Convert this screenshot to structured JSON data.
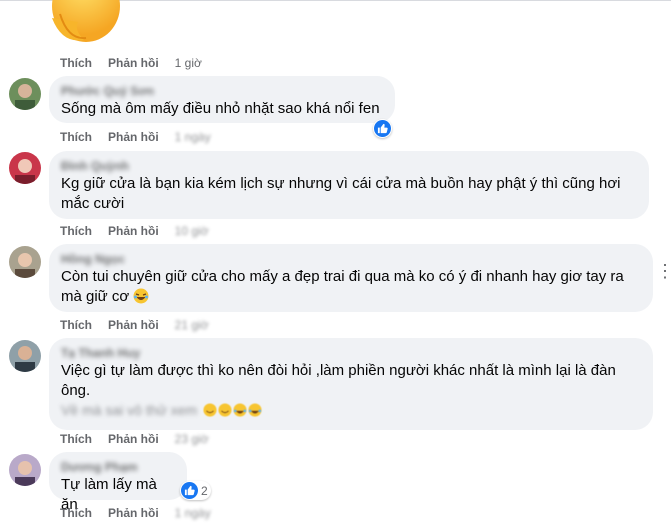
{
  "actions": {
    "like": "Thích",
    "reply": "Phản hồi"
  },
  "top": {
    "time": "1 giờ"
  },
  "comments": [
    {
      "name": "Phước Quý Sơn",
      "text": "Sống mà ôm mấy điều nhỏ nhặt sao khá nổi fen",
      "time": "1 ngày"
    },
    {
      "name": "Đình Quỳnh",
      "text_line1": "Kg giữ cửa là bạn kia kém lịch sự nhưng vì cái cửa mà buồn hay phật ý thì cũng hơi",
      "text_line2": "mắc cười",
      "time": "10 giờ"
    },
    {
      "name": "Hồng Ngọc",
      "text_line1": "Còn tui chuyên giữ cửa cho mấy a đẹp trai đi qua mà ko có ý đi nhanh hay giơ tay ra",
      "text_line2": "mà giữ cơ",
      "time": "21 giờ"
    },
    {
      "name": "Tạ Thanh Huy",
      "text_line1": "Việc gì tự làm được thì ko nên đòi hỏi ,làm phiền người khác nhất là mình lại là đàn",
      "text_line2": "ông.",
      "reply_preview": "Về mà sai vô thử xem",
      "time": "23 giờ"
    },
    {
      "name": "Dương Phạm",
      "text": "Tự làm lấy mà ăn",
      "reaction_count": "2",
      "time": "1 ngày"
    }
  ],
  "icons": {
    "like_reaction": "thumbs-up-icon",
    "more": "more-icon",
    "laugh": "laughing-emoji-icon"
  },
  "colors": {
    "bubble": "#f0f2f5",
    "secondary_text": "#65676b",
    "like_blue": "#1877f2"
  }
}
